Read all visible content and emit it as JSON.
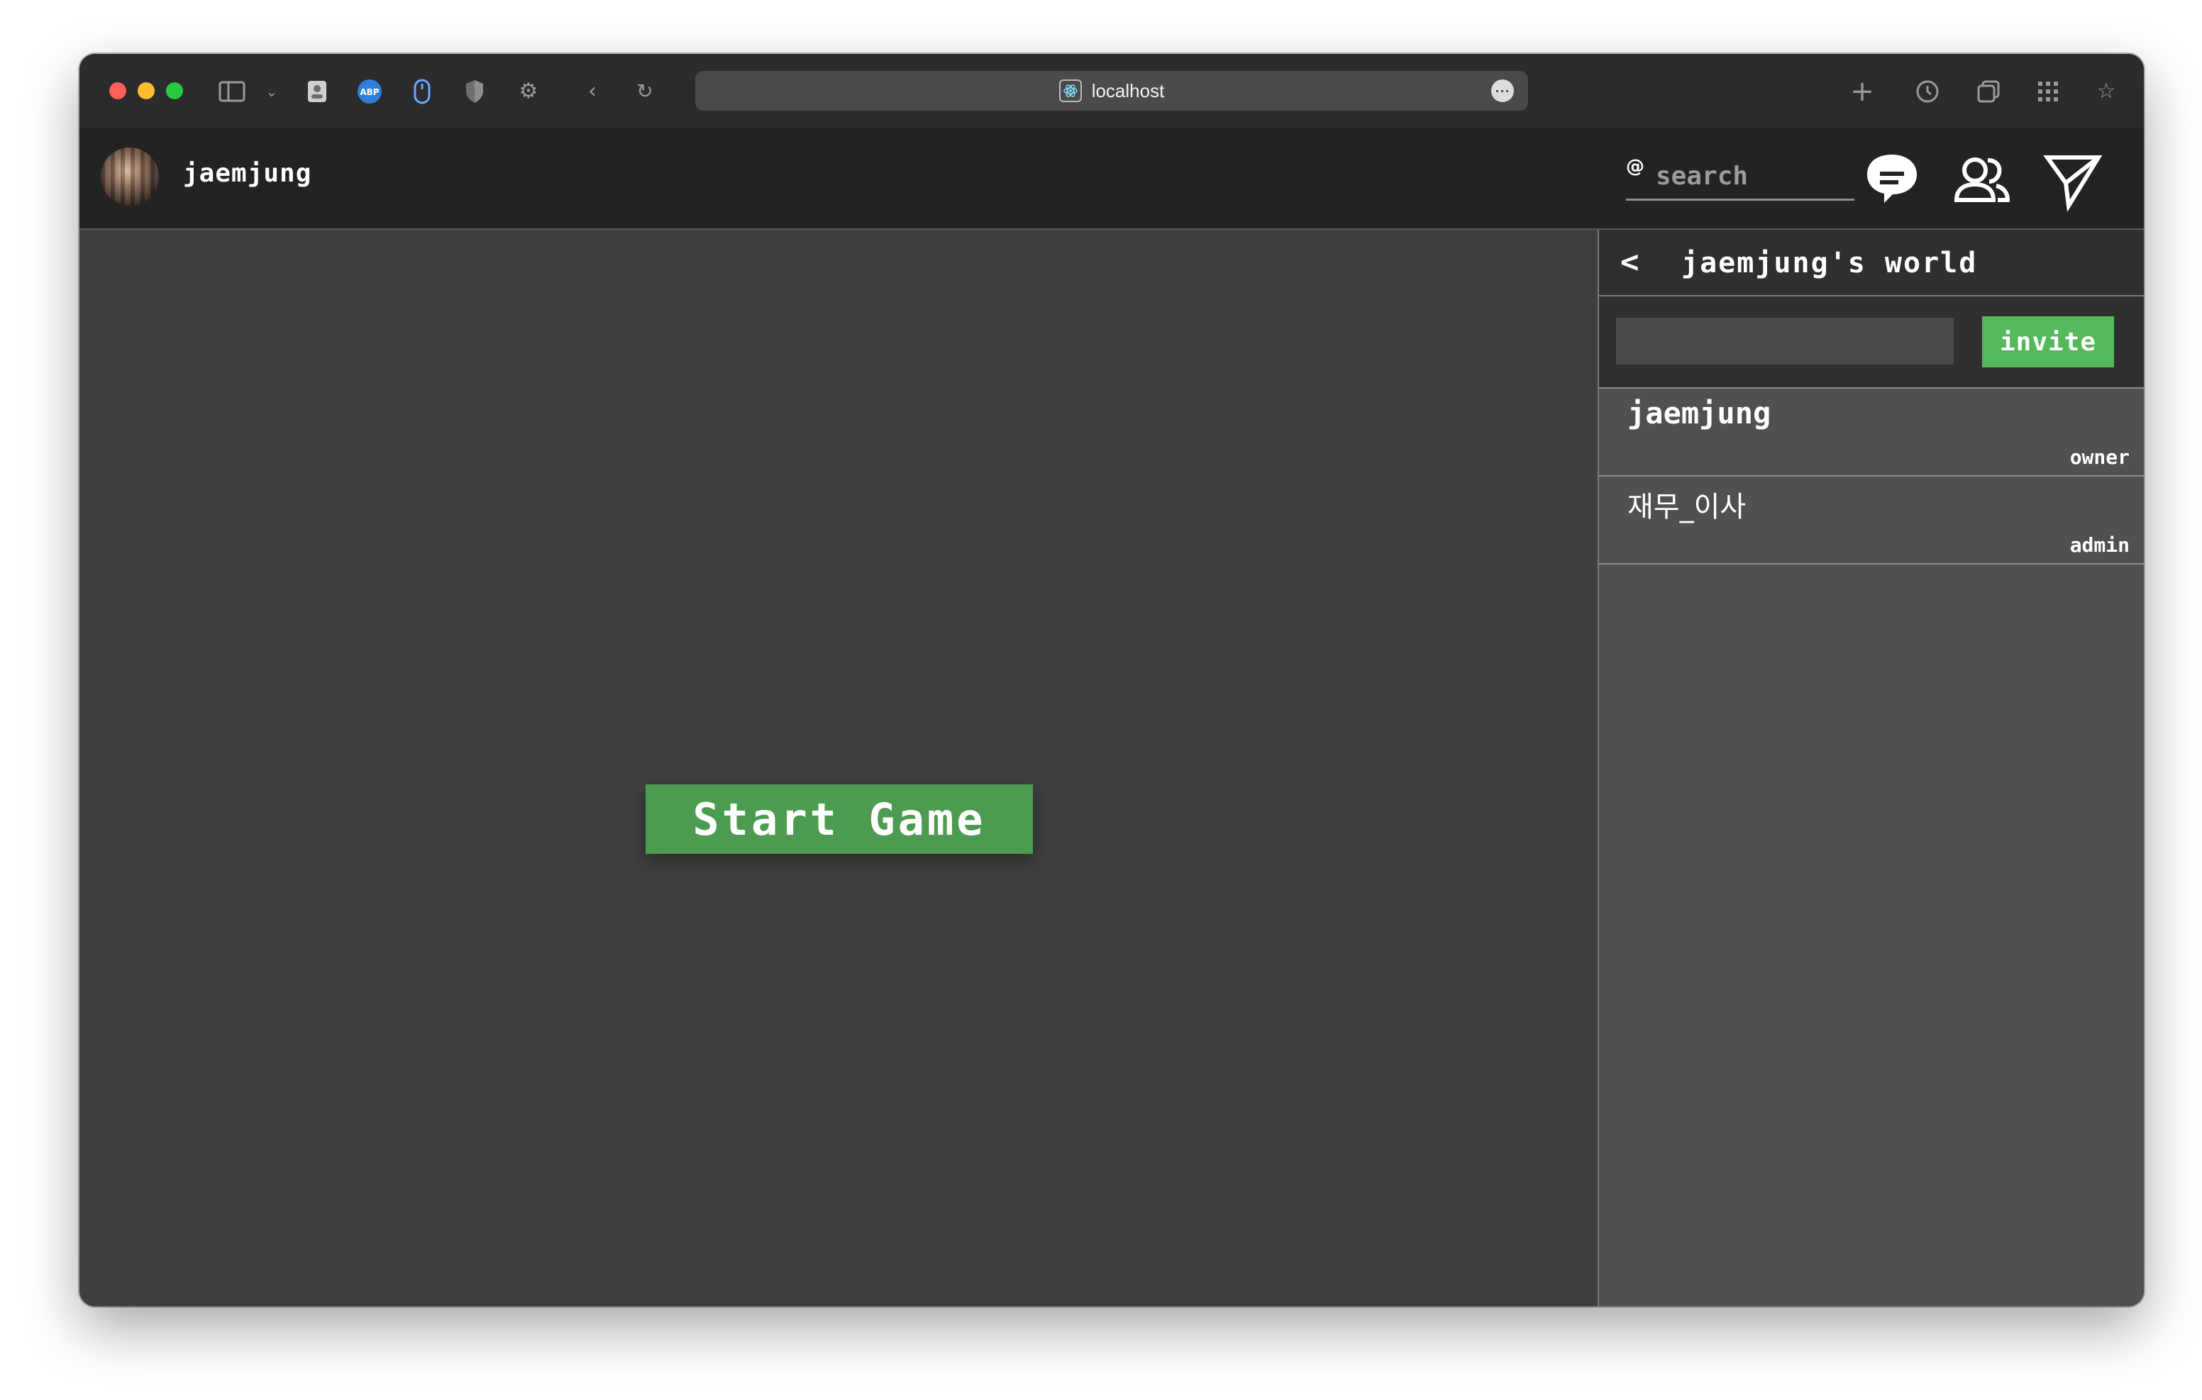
{
  "browser": {
    "address": "localhost"
  },
  "header": {
    "username": "jaemjung",
    "search": {
      "at_symbol": "@",
      "placeholder": "search"
    }
  },
  "main": {
    "start_button": "Start Game"
  },
  "panel": {
    "back_icon": "<",
    "title": "jaemjung's world",
    "invite_button": "invite",
    "members": [
      {
        "name": "jaemjung",
        "role": "owner"
      },
      {
        "name": "재무_이사",
        "role": "admin"
      }
    ]
  },
  "colors": {
    "accent_green": "#4d9b50",
    "invite_green": "#55b85a",
    "header_bg": "#232323",
    "main_bg": "#3f3f3f",
    "panel_bg": "#505050"
  }
}
